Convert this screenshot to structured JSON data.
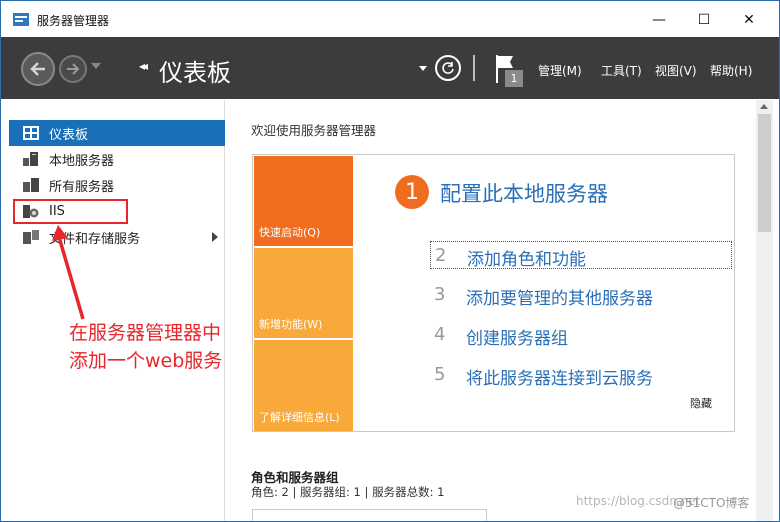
{
  "window": {
    "title": "服务器管理器",
    "controls": {
      "minimize": "—",
      "maximize": "☐",
      "close": "✕"
    }
  },
  "header": {
    "breadcrumb_arrows": "◂◂",
    "page_title": "仪表板",
    "notification_count": "1",
    "menus": [
      "管理(M)",
      "工具(T)",
      "视图(V)",
      "帮助(H)"
    ]
  },
  "sidebar": {
    "items": [
      {
        "label": "仪表板",
        "icon": "dashboard-icon",
        "active": true
      },
      {
        "label": "本地服务器",
        "icon": "server-icon",
        "active": false
      },
      {
        "label": "所有服务器",
        "icon": "servers-icon",
        "active": false
      },
      {
        "label": "IIS",
        "icon": "iis-icon",
        "active": false
      },
      {
        "label": "文件和存储服务",
        "icon": "storage-icon",
        "active": false,
        "has_submenu": true
      }
    ]
  },
  "annotation": {
    "line1": "在服务器管理器中",
    "line2": "添加一个web服务",
    "color": "#e8262b"
  },
  "main": {
    "welcome": "欢迎使用服务器管理器",
    "quick_start": {
      "tiles": [
        "快速启动(Q)",
        "新增功能(W)",
        "了解详细信息(L)"
      ],
      "step1_num": "1",
      "step1_text": "配置此本地服务器",
      "steps": [
        {
          "num": "2",
          "text": "添加角色和功能"
        },
        {
          "num": "3",
          "text": "添加要管理的其他服务器"
        },
        {
          "num": "4",
          "text": "创建服务器组"
        },
        {
          "num": "5",
          "text": "将此服务器连接到云服务"
        }
      ],
      "hide": "隐藏"
    },
    "roles": {
      "title": "角色和服务器组",
      "summary": "角色: 2 | 服务器组: 1 | 服务器总数: 1"
    }
  },
  "watermark": {
    "left": "https://blog.csdn.net",
    "right": "@51CTO博客"
  },
  "colors": {
    "accent": "#1a6fb9",
    "header_bg": "#3c3c3c",
    "tile_orange": "#f06c1e",
    "tile_light": "#f9a93a",
    "link_blue": "#2a6fb8"
  }
}
